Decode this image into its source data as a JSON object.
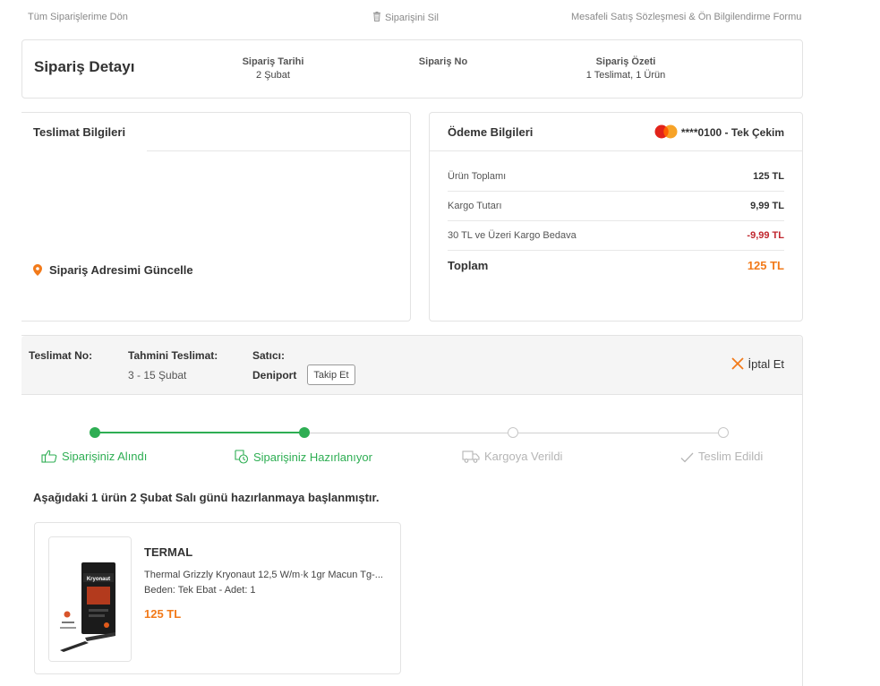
{
  "top_links": {
    "back": "Tüm Siparişlerime Dön",
    "delete": "Siparişini Sil",
    "contract": "Mesafeli Satış Sözleşmesi & Ön Bilgilendirme Formu"
  },
  "order": {
    "title": "Sipariş Detayı",
    "date_label": "Sipariş Tarihi",
    "date_value": "2 Şubat",
    "no_label": "Sipariş No",
    "summary_label": "Sipariş Özeti",
    "summary_value": "1 Teslimat, 1 Ürün"
  },
  "delivery": {
    "title": "Teslimat Bilgileri",
    "update_address": "Sipariş Adresimi Güncelle"
  },
  "payment": {
    "title": "Ödeme Bilgileri",
    "card_brand": "MasterCard",
    "card_info": "****0100 - Tek Çekim",
    "rows": [
      {
        "label": "Ürün Toplamı",
        "value": "125 TL"
      },
      {
        "label": "Kargo Tutarı",
        "value": "9,99 TL"
      },
      {
        "label": "30 TL ve Üzeri Kargo Bedava",
        "value": "-9,99 TL"
      }
    ],
    "total_label": "Toplam",
    "total_value": "125 TL"
  },
  "shipment": {
    "no_label": "Teslimat No:",
    "eta_label": "Tahmini Teslimat:",
    "eta_value": "3 - 15 Şubat",
    "seller_label": "Satıcı:",
    "seller_value": "Deniport",
    "follow_label": "Takip Et",
    "cancel_label": "İptal Et"
  },
  "progress": {
    "steps": [
      {
        "label": "Siparişiniz Alındı",
        "status": "done",
        "icon": "thumbs-up-icon"
      },
      {
        "label": "Siparişiniz Hazırlanıyor",
        "status": "done",
        "icon": "clock-box-icon"
      },
      {
        "label": "Kargoya Verildi",
        "status": "todo",
        "icon": "truck-icon"
      },
      {
        "label": "Teslim Edildi",
        "status": "todo",
        "icon": "check-icon"
      }
    ]
  },
  "prep_message": "Aşağıdaki 1 ürün 2 Şubat Salı günü hazırlanmaya başlanmıştır.",
  "product": {
    "brand": "TERMAL",
    "name": "Thermal Grizzly Kryonaut 12,5 W/m·k 1gr Macun Tg-...",
    "variant": "Beden: Tek Ebat - Adet: 1",
    "price": "125 TL",
    "image_text": "Kryonaut"
  },
  "colors": {
    "accent_orange": "#f27a1a",
    "success_green": "#2eae53",
    "discount_red": "#c0262d"
  }
}
